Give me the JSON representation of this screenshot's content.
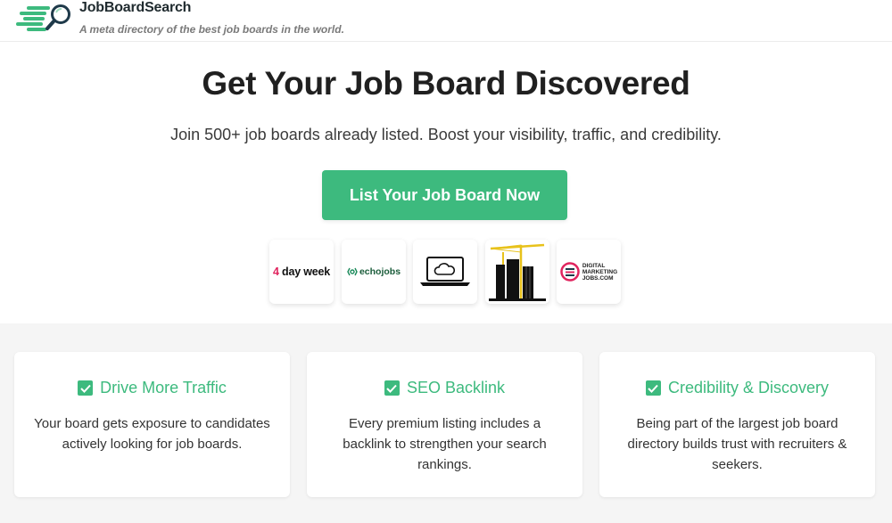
{
  "header": {
    "brand_name": "JobBoardSearch",
    "tagline": "A meta directory of the best job boards in the world."
  },
  "hero": {
    "title": "Get Your Job Board Discovered",
    "subtitle": "Join 500+ job boards already listed. Boost your visibility, traffic, and credibility.",
    "cta_label": "List Your Job Board Now"
  },
  "logos": [
    {
      "name": "4 day week",
      "four": "4",
      "rest": " day week"
    },
    {
      "name": "echojobs",
      "text": "echojobs"
    },
    {
      "name": "laptop-cloud",
      "icon": "laptop-cloud-icon"
    },
    {
      "name": "construction-building",
      "icon": "crane-building-icon"
    },
    {
      "name": "Digital Marketing Jobs",
      "line1": "DIGITAL",
      "line2": "MARKETING",
      "line3": "JOBS.COM"
    }
  ],
  "features": [
    {
      "title": "Drive More Traffic",
      "body": "Your board gets exposure to candidates actively looking for job boards."
    },
    {
      "title": "SEO Backlink",
      "body": "Every premium listing includes a backlink to strengthen your search rankings."
    },
    {
      "title": "Credibility & Discovery",
      "body": "Being part of the largest job board directory builds trust with recruiters & seekers."
    }
  ],
  "colors": {
    "accent": "#3dba7e",
    "brand_dark": "#1f3a4a",
    "pink": "#e0245e"
  }
}
